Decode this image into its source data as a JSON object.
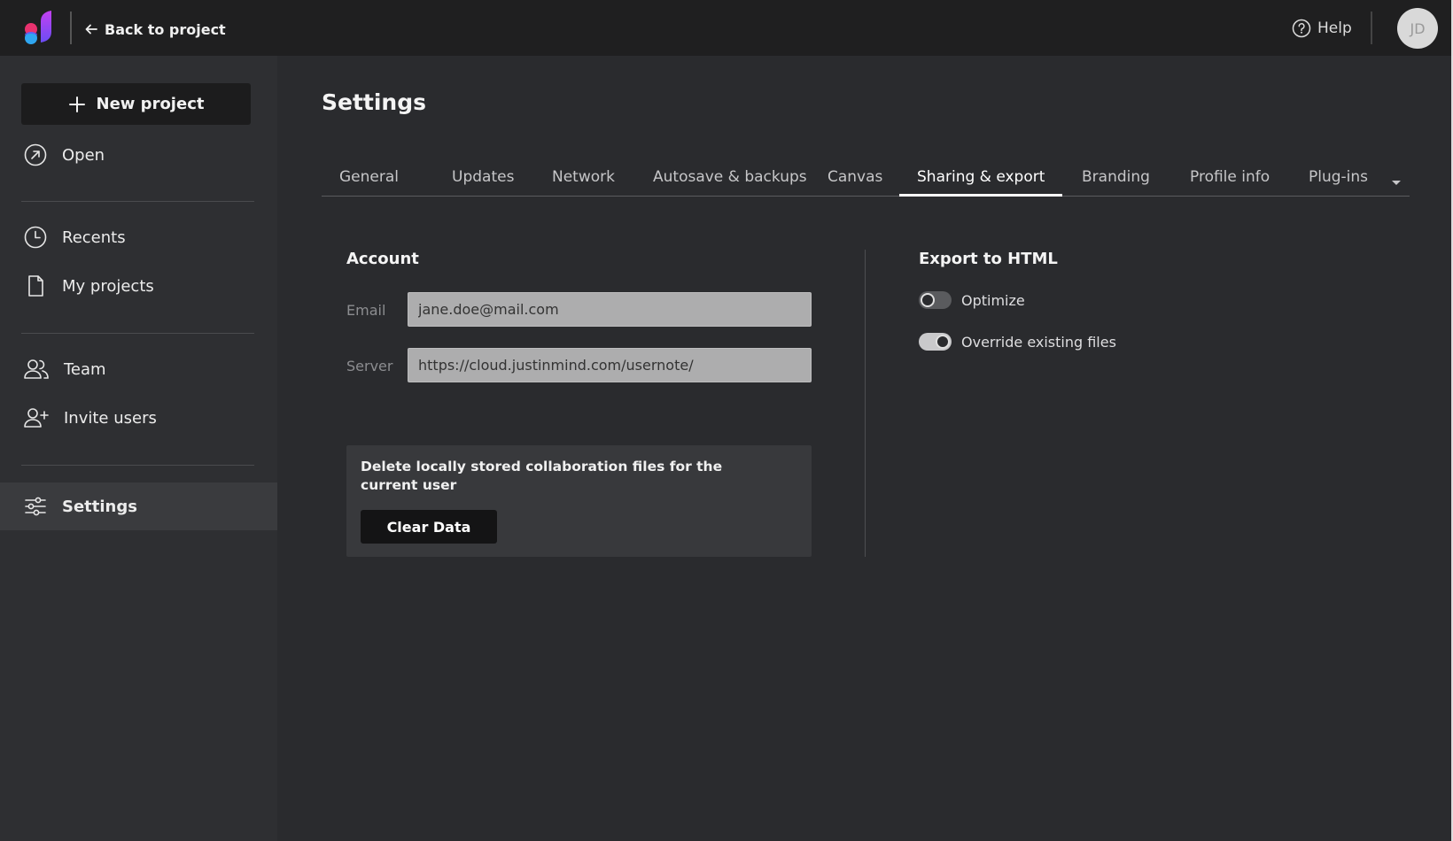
{
  "topbar": {
    "back_label": "Back to project",
    "help_label": "Help",
    "avatar_initials": "JD"
  },
  "sidebar": {
    "new_project_label": "New project",
    "items": [
      {
        "label": "Open",
        "icon": "open-icon"
      },
      {
        "label": "Recents",
        "icon": "clock-icon"
      },
      {
        "label": "My projects",
        "icon": "document-icon"
      },
      {
        "label": "Team",
        "icon": "team-icon"
      },
      {
        "label": "Invite users",
        "icon": "add-user-icon"
      },
      {
        "label": "Settings",
        "icon": "sliders-icon",
        "active": true
      }
    ]
  },
  "main": {
    "title": "Settings",
    "tabs": [
      {
        "label": "General"
      },
      {
        "label": "Updates"
      },
      {
        "label": "Network"
      },
      {
        "label": "Autosave & backups"
      },
      {
        "label": "Canvas"
      },
      {
        "label": "Sharing & export",
        "active": true
      },
      {
        "label": "Branding"
      },
      {
        "label": "Profile info"
      },
      {
        "label": "Plug-ins"
      }
    ],
    "account": {
      "title": "Account",
      "email_label": "Email",
      "email_value": "jane.doe@mail.com",
      "server_label": "Server",
      "server_value": "https://cloud.justinmind.com/usernote/",
      "clear_text": "Delete locally stored collaboration files for the current user",
      "clear_button": "Clear Data"
    },
    "export": {
      "title": "Export to HTML",
      "optimize_label": "Optimize",
      "optimize_on": false,
      "override_label": "Override existing files",
      "override_on": true
    }
  },
  "colors": {
    "topbar_bg": "#1f1f20",
    "sidebar_bg": "#2e2f32",
    "main_bg": "#2a2b2e",
    "logo_pink": "#e8326e",
    "logo_blue": "#2fa6f0",
    "logo_purple": "#8b4bf5"
  }
}
